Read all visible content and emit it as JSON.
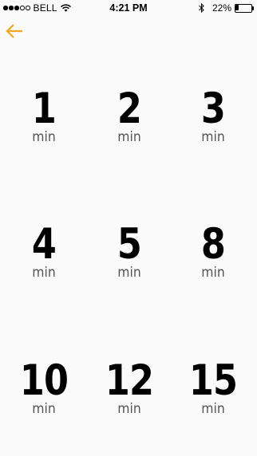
{
  "status_bar": {
    "carrier": "BELL",
    "time": "4:21 PM",
    "battery_percent": "22%",
    "battery_level": 0.22,
    "signal_bars_filled": 3,
    "signal_bars_total": 5,
    "icons": [
      "wifi-icon",
      "bluetooth-icon",
      "battery-icon"
    ]
  },
  "nav": {
    "back_icon": "arrow-left-icon",
    "accent_color": "#f5a623"
  },
  "duration_options": [
    {
      "value": "1",
      "unit": "min"
    },
    {
      "value": "2",
      "unit": "min"
    },
    {
      "value": "3",
      "unit": "min"
    },
    {
      "value": "4",
      "unit": "min"
    },
    {
      "value": "5",
      "unit": "min"
    },
    {
      "value": "8",
      "unit": "min"
    },
    {
      "value": "10",
      "unit": "min"
    },
    {
      "value": "12",
      "unit": "min"
    },
    {
      "value": "15",
      "unit": "min"
    }
  ]
}
